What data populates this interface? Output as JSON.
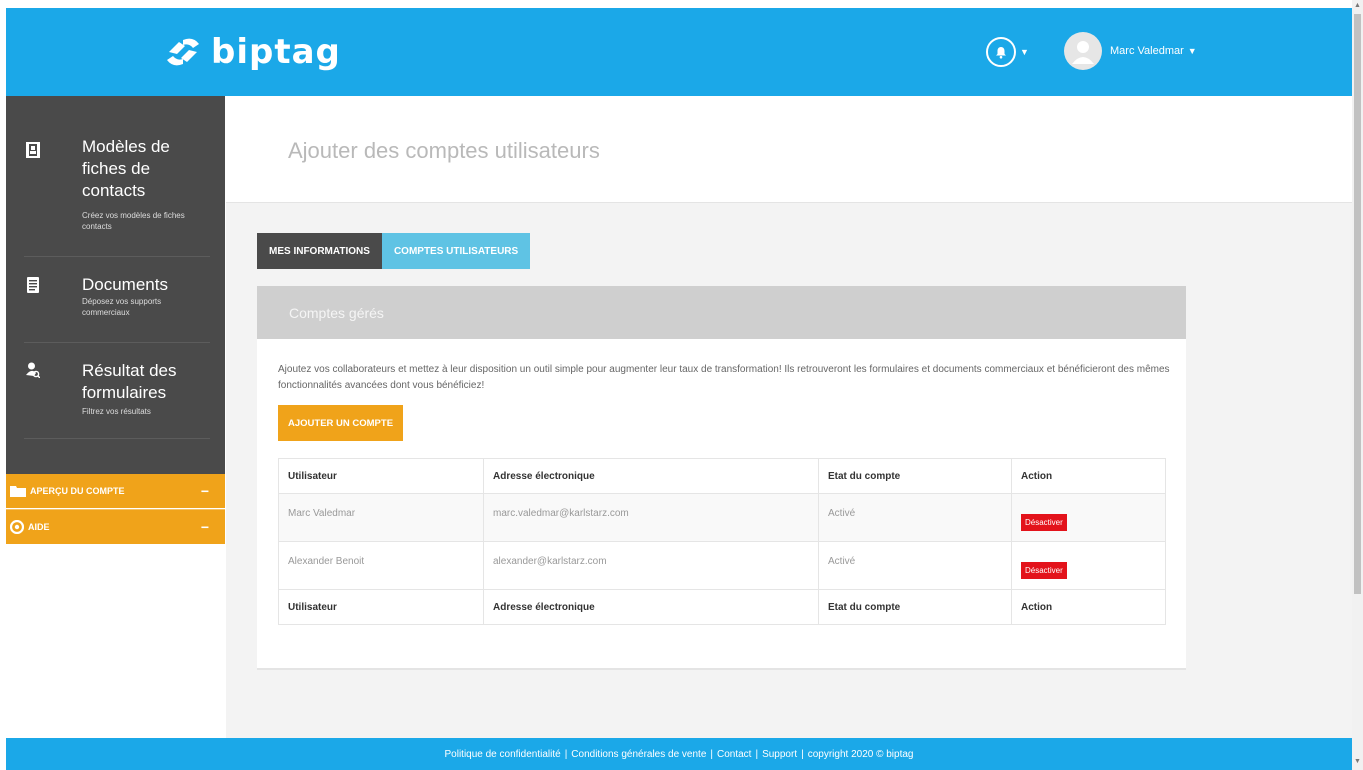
{
  "header": {
    "logo_text": "biptag",
    "user_name": "Marc Valedmar",
    "brand_color": "#1ba8e8"
  },
  "sidebar": {
    "items": [
      {
        "title": "Modèles de fiches de contacts",
        "subtitle": "Créez vos modèles de fiches contacts",
        "icon": "address-book-icon"
      },
      {
        "title": "Documents",
        "subtitle": "Déposez vos supports commerciaux",
        "icon": "document-icon"
      },
      {
        "title": "Résultat des formulaires",
        "subtitle": "Filtrez vos résultats",
        "icon": "user-search-icon"
      }
    ],
    "accordions": [
      {
        "label": "APERÇU DU COMPTE",
        "toggle": "−",
        "icon": "folder-icon"
      },
      {
        "label": "AIDE",
        "toggle": "−",
        "icon": "lifebuoy-icon"
      }
    ],
    "accent_color": "#f0a31a"
  },
  "page": {
    "title": "Ajouter des comptes utilisateurs"
  },
  "tabs": [
    {
      "label": "MES INFORMATIONS",
      "active": false
    },
    {
      "label": "COMPTES UTILISATEURS",
      "active": true
    }
  ],
  "panel": {
    "heading": "Comptes gérés",
    "description": "Ajoutez vos collaborateurs et mettez à leur disposition un outil simple pour augmenter leur taux de transformation! Ils retrouveront les formulaires et documents commerciaux et bénéficieront des mêmes fonctionnalités avancées dont vous bénéficiez!",
    "add_button": "AJOUTER UN COMPTE"
  },
  "table": {
    "columns": [
      "Utilisateur",
      "Adresse électronique",
      "Etat du compte",
      "Action"
    ],
    "rows": [
      {
        "user": "Marc Valedmar",
        "email": "marc.valedmar@karlstarz.com",
        "status": "Activé",
        "action": "Désactiver"
      },
      {
        "user": "Alexander Benoit",
        "email": "alexander@karlstarz.com",
        "status": "Activé",
        "action": "Désactiver"
      }
    ]
  },
  "footer": {
    "links": [
      "Politique de confidentialité",
      "Conditions générales de vente",
      "Contact",
      "Support"
    ],
    "separator": "|",
    "copyright": "copyright 2020 © biptag"
  }
}
